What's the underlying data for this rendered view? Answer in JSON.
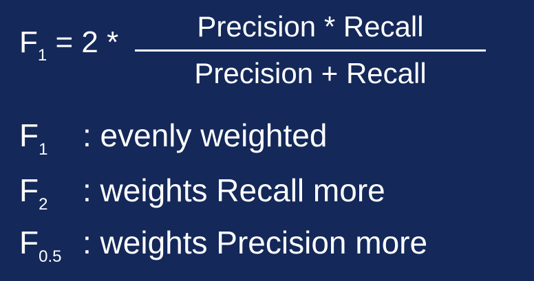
{
  "formula": {
    "lhs_symbol": "F",
    "lhs_subscript": "1",
    "lhs_operator": " = 2 *",
    "numerator": "Precision * Recall",
    "denominator": "Precision + Recall"
  },
  "rows": [
    {
      "symbol": "F",
      "subscript": "1",
      "text": ": evenly weighted"
    },
    {
      "symbol": "F",
      "subscript": "2",
      "text": ": weights Recall more"
    },
    {
      "symbol": "F",
      "subscript": "0.5",
      "text": ": weights Precision more"
    }
  ],
  "colors": {
    "background": "#142859",
    "text": "#ffffff"
  }
}
